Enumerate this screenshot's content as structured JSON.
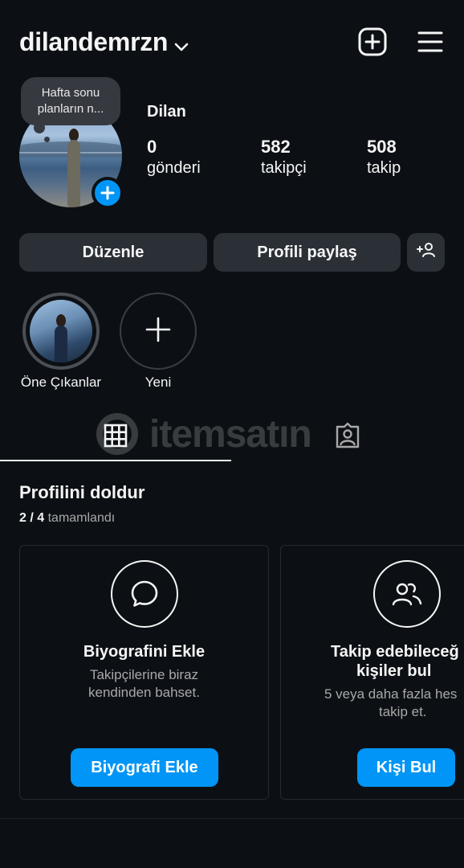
{
  "header": {
    "username": "dilandemrzn",
    "icons": [
      "chevron-down-icon",
      "plus-square-icon",
      "menu-icon"
    ]
  },
  "profile": {
    "note": "Hafta sonu planların n...",
    "display_name": "Dilan",
    "stats": [
      {
        "value": "0",
        "label": "gönderi"
      },
      {
        "value": "582",
        "label": "takipçi"
      },
      {
        "value": "508",
        "label": "takip"
      }
    ]
  },
  "actions": {
    "edit": "Düzenle",
    "share": "Profili paylaş"
  },
  "highlights": [
    {
      "label": "Öne Çıkanlar"
    },
    {
      "label": "Yeni"
    }
  ],
  "watermark": "itemsatın",
  "complete_profile": {
    "title": "Profilini doldur",
    "progress_done": "2 / 4",
    "progress_suffix": "tamamlandı",
    "cards": [
      {
        "title": "Biyografini Ekle",
        "desc_line1": "Takipçilerine biraz",
        "desc_line2": "kendinden bahset.",
        "button": "Biyografi Ekle"
      },
      {
        "title_line1": "Takip edebileceğ",
        "title_line2": "kişiler bul",
        "desc_line1": "5 veya daha fazla hes",
        "desc_line2": "takip et.",
        "button": "Kişi Bul"
      }
    ]
  },
  "colors": {
    "background": "#0c1014",
    "button": "#2b3036",
    "accent": "#0095f6"
  }
}
